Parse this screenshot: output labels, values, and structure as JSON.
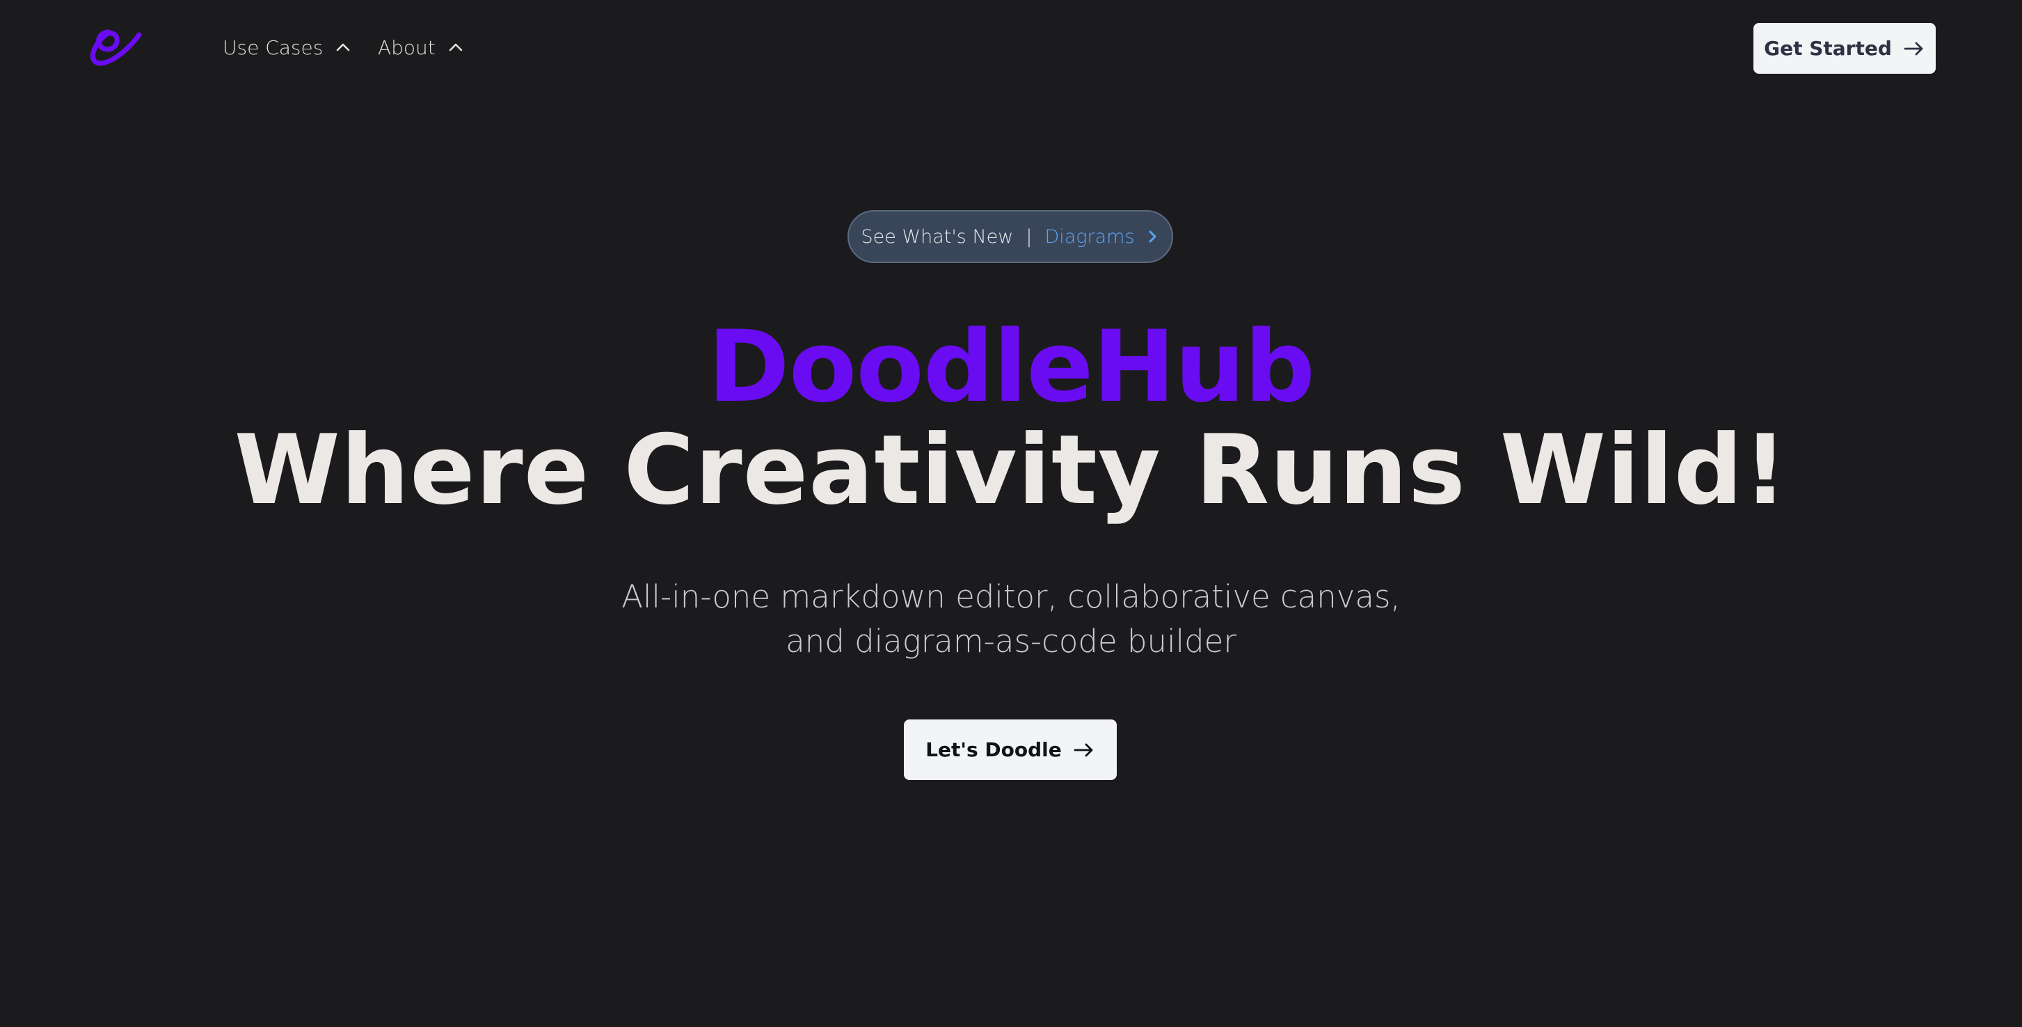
{
  "header": {
    "logo_icon": "doodlehub-squiggle-logo",
    "nav": [
      {
        "label": "Use Cases",
        "icon": "chevron-up-icon"
      },
      {
        "label": "About",
        "icon": "chevron-up-icon"
      }
    ],
    "get_started_label": "Get Started",
    "get_started_icon": "arrow-right-icon"
  },
  "announcement": {
    "prefix": "See What's New",
    "separator": "|",
    "link_label": "Diagrams",
    "icon": "chevron-right-icon"
  },
  "hero": {
    "brand": "DoodleHub",
    "title": "Where Creativity Runs Wild!",
    "subtitle_line1": "All-in-one markdown editor, collaborative canvas,",
    "subtitle_line2": "and diagram-as-code builder",
    "cta_label": "Let's Doodle",
    "cta_icon": "arrow-right-icon"
  },
  "colors": {
    "background": "#1b1b1d",
    "brand_purple": "#6a0cf2",
    "link_blue": "#5aa5f5",
    "button_bg": "#f3f4f6",
    "pill_bg": "#394559"
  }
}
